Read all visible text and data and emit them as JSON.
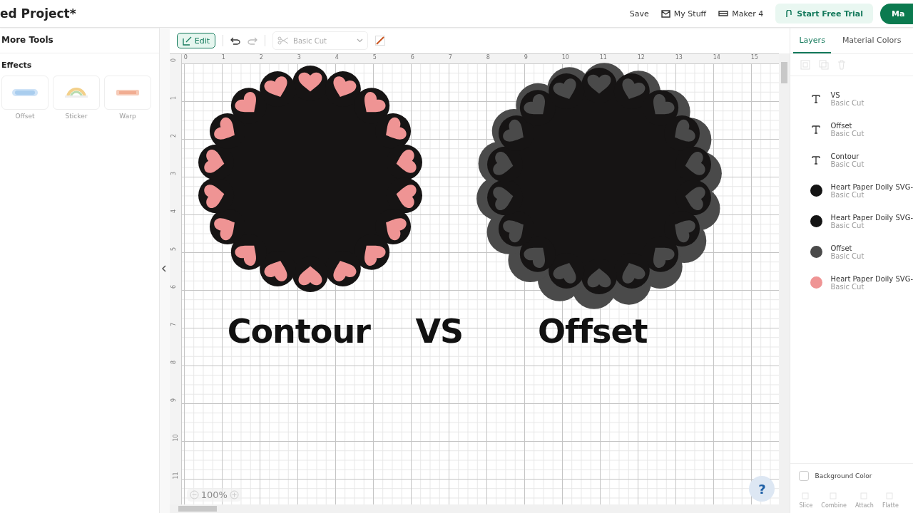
{
  "header": {
    "title": "ed Project*",
    "save": "Save",
    "my_stuff": "My Stuff",
    "machine": "Maker 4",
    "trial": "Start Free Trial",
    "make": "Ma"
  },
  "left_panel": {
    "title": "More Tools",
    "section": "Effects",
    "effects": [
      {
        "label": "Offset"
      },
      {
        "label": "Sticker"
      },
      {
        "label": "Warp"
      }
    ]
  },
  "toolbar": {
    "edit": "Edit",
    "operation": "Basic Cut"
  },
  "canvas": {
    "x_ruler": [
      "0",
      "1",
      "2",
      "3",
      "4",
      "5",
      "6",
      "7",
      "8",
      "9",
      "10",
      "11",
      "12",
      "13",
      "14",
      "15"
    ],
    "y_ruler": [
      "0",
      "1",
      "2",
      "3",
      "4",
      "5",
      "6",
      "7",
      "8",
      "9",
      "10",
      "11"
    ],
    "designs": [
      {
        "kind": "contour"
      },
      {
        "kind": "offset"
      }
    ],
    "labels": [
      "Contour",
      "VS",
      "Offset"
    ],
    "zoom": "100%",
    "help": "?"
  },
  "right_panel": {
    "tabs": [
      {
        "label": "Layers",
        "selected": true
      },
      {
        "label": "Material Colors",
        "selected": false
      }
    ],
    "layers": [
      {
        "kind": "text",
        "name": "VS",
        "operation": "Basic Cut"
      },
      {
        "kind": "text",
        "name": "Offset",
        "operation": "Basic Cut"
      },
      {
        "kind": "text",
        "name": "Contour",
        "operation": "Basic Cut"
      },
      {
        "kind": "shape",
        "name": "Heart Paper Doily SVG-",
        "operation": "Basic Cut",
        "color": "#141414"
      },
      {
        "kind": "shape",
        "name": "Heart Paper Doily SVG-",
        "operation": "Basic Cut",
        "color": "#141414"
      },
      {
        "kind": "shape",
        "name": "Offset",
        "operation": "Basic Cut",
        "color": "#4a4a4a"
      },
      {
        "kind": "shape",
        "name": "Heart Paper Doily SVG-",
        "operation": "Basic Cut",
        "color": "#ef9494"
      }
    ],
    "background_color": "Background Color",
    "background_checked": false,
    "actions": [
      "Slice",
      "Combine",
      "Attach",
      "Flatte"
    ]
  }
}
